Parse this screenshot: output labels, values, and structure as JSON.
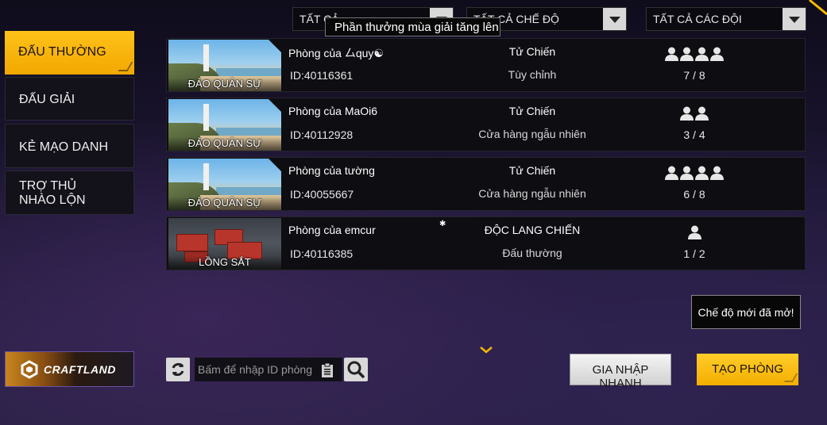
{
  "filters": {
    "all": "TẤT CẢ",
    "all_modes": "TẤT CẢ CHẾ ĐỘ",
    "all_teams": "TẤT CẢ CÁC ĐỘI"
  },
  "tooltip": "Phần thưởng mùa giải tăng lên",
  "tabs": [
    {
      "label": "ĐẤU THƯỜNG",
      "active": true
    },
    {
      "label": "ĐẤU GIẢI",
      "active": false
    },
    {
      "label": "KẺ MẠO DANH",
      "active": false
    },
    {
      "label": "TRỢ THỦ NHÀO LỘN",
      "active": false
    }
  ],
  "rooms": [
    {
      "map": "ĐẢO QUÂN SỰ",
      "name": "Phòng của 厶quy☯",
      "id": "ID:40116361",
      "mode": "Tử Chiến",
      "sub": "Tùy chỉnh",
      "count": "7 / 8",
      "icons": 4
    },
    {
      "map": "ĐẢO QUÂN SỰ",
      "name": "Phòng của MaOi6",
      "id": "ID:40112928",
      "mode": "Tử Chiến",
      "sub": "Cửa hàng ngẫu nhiên",
      "count": "3 / 4",
      "icons": 2
    },
    {
      "map": "ĐẢO QUÂN SỰ",
      "name": "Phòng của tường",
      "id": "ID:40055667",
      "mode": "Tử Chiến",
      "sub": "Cửa hàng ngẫu nhiên",
      "count": "6 / 8",
      "icons": 4
    },
    {
      "map": "LỒNG SẮT",
      "name": "Phòng của emcur",
      "id": "ID:40116385",
      "mode": "ĐỘC LANG CHIẾN",
      "sub": "Đấu thường",
      "count": "1 / 2",
      "icons": 1
    }
  ],
  "new_mode_notice": "Chế độ mới đã mở!",
  "craftland": "CRAFTLAND",
  "search": {
    "placeholder": "Bấm để nhập ID phòng"
  },
  "buttons": {
    "quick_join": "GIA NHẬP NHANH",
    "create_room": "TẠO PHÒNG"
  },
  "colors": {
    "accent": "#f7b500",
    "panel": "#0d0d12"
  }
}
